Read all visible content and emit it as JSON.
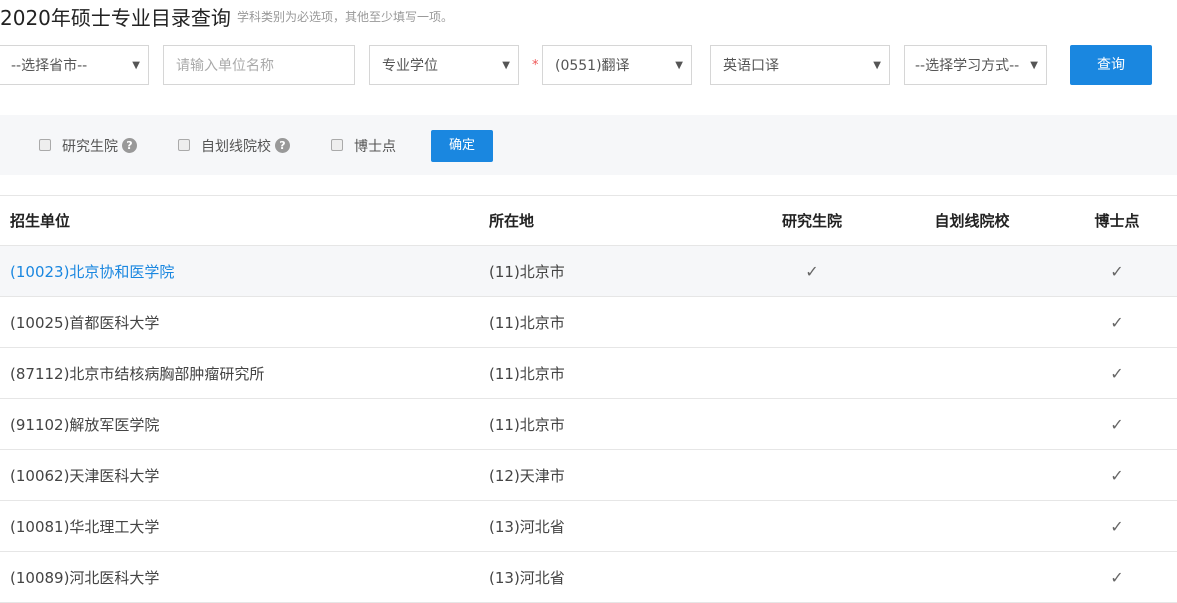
{
  "header": {
    "title": "2020年硕士专业目录查询",
    "hint": "学科类别为必选项，其他至少填写一项。"
  },
  "filters": {
    "province": "--选择省市--",
    "unit_placeholder": "请输入单位名称",
    "degree": "专业学位",
    "required_mark": "*",
    "subject": "(0551)翻译",
    "major": "英语口译",
    "study_mode": "--选择学习方式--",
    "query_label": "查询"
  },
  "options": {
    "graduate_school": "研究生院",
    "self_line": "自划线院校",
    "doctoral": "博士点",
    "help": "?",
    "confirm_label": "确定"
  },
  "table": {
    "headers": [
      "招生单位",
      "所在地",
      "研究生院",
      "自划线院校",
      "博士点"
    ],
    "rows": [
      {
        "unit": "(10023)北京协和医学院",
        "location": "(11)北京市",
        "grad": "✓",
        "self": "",
        "doc": "✓"
      },
      {
        "unit": "(10025)首都医科大学",
        "location": "(11)北京市",
        "grad": "",
        "self": "",
        "doc": "✓"
      },
      {
        "unit": "(87112)北京市结核病胸部肿瘤研究所",
        "location": "(11)北京市",
        "grad": "",
        "self": "",
        "doc": "✓"
      },
      {
        "unit": "(91102)解放军医学院",
        "location": "(11)北京市",
        "grad": "",
        "self": "",
        "doc": "✓"
      },
      {
        "unit": "(10062)天津医科大学",
        "location": "(12)天津市",
        "grad": "",
        "self": "",
        "doc": "✓"
      },
      {
        "unit": "(10081)华北理工大学",
        "location": "(13)河北省",
        "grad": "",
        "self": "",
        "doc": "✓"
      },
      {
        "unit": "(10089)河北医科大学",
        "location": "(13)河北省",
        "grad": "",
        "self": "",
        "doc": "✓"
      }
    ]
  }
}
